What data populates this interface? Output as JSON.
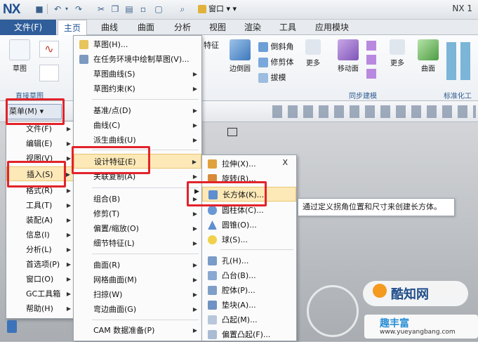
{
  "window": {
    "logo": "NX",
    "quick_menu": "窗口",
    "app_title": "NX 1"
  },
  "ribbon_tabs": [
    "主页",
    "曲线",
    "曲面",
    "分析",
    "视图",
    "渲染",
    "工具",
    "应用模块"
  ],
  "file_tab": "文件(F)",
  "ribbon": {
    "sketch": "草图",
    "sketch_group": "直接草图",
    "feature_partial": "特征",
    "edge_blend": "边倒圆",
    "chamfer": "倒斜角",
    "trim_body": "修剪体",
    "draft": "拔模",
    "more1": "更多",
    "move_face": "移动面",
    "more2": "更多",
    "sync_group": "同步建模",
    "surface": "曲面",
    "surface_group": "标准化工具"
  },
  "menu_button": "菜单(M)",
  "main_menu": [
    "文件(F)",
    "编辑(E)",
    "视图(V)",
    "插入(S)",
    "格式(R)",
    "工具(T)",
    "装配(A)",
    "信息(I)",
    "分析(L)",
    "首选项(P)",
    "窗口(O)",
    "GC工具箱",
    "帮助(H)"
  ],
  "insert_menu": {
    "items": [
      {
        "label": "草图(H)...",
        "arrow": false
      },
      {
        "label": "在任务环境中绘制草图(V)...",
        "arrow": false
      },
      {
        "label": "草图曲线(S)",
        "arrow": true
      },
      {
        "label": "草图约束(K)",
        "arrow": true
      },
      {
        "label": "基准/点(D)",
        "arrow": true
      },
      {
        "label": "曲线(C)",
        "arrow": true
      },
      {
        "label": "派生曲线(U)",
        "arrow": true
      },
      {
        "label": "设计特征(E)",
        "arrow": true
      },
      {
        "label": "关联复制(A)",
        "arrow": true
      },
      {
        "label": "组合(B)",
        "arrow": true
      },
      {
        "label": "修剪(T)",
        "arrow": true
      },
      {
        "label": "偏置/缩放(O)",
        "arrow": true
      },
      {
        "label": "细节特征(L)",
        "arrow": true
      },
      {
        "label": "曲面(R)",
        "arrow": true
      },
      {
        "label": "网格曲面(M)",
        "arrow": true
      },
      {
        "label": "扫掠(W)",
        "arrow": true
      },
      {
        "label": "弯边曲面(G)",
        "arrow": true
      },
      {
        "label": "CAM 数据准备(P)",
        "arrow": true
      }
    ]
  },
  "design_feature_menu": {
    "close": "X",
    "items": [
      "拉伸(X)...",
      "旋转(R)...",
      "长方体(K)...",
      "圆柱体(C)...",
      "圆锥(O)...",
      "球(S)...",
      "孔(H)...",
      "凸台(B)...",
      "腔体(P)...",
      "垫块(A)...",
      "凸起(M)...",
      "偏置凸起(F)..."
    ]
  },
  "tooltip": "通过定义拐角位置和尺寸来创建长方体。",
  "watermark": {
    "brand": "酷知网",
    "site": "www.yueyangbang.com",
    "tagline": "趣丰富"
  }
}
